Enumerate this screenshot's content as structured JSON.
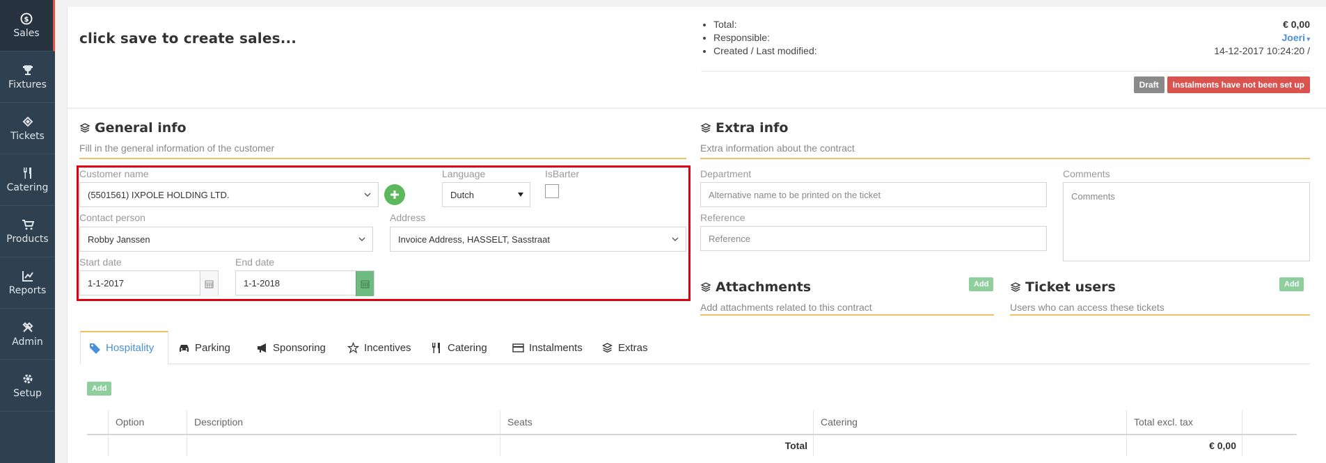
{
  "sidebar": {
    "items": [
      {
        "label": "Sales",
        "icon": "dollar-icon",
        "active": true
      },
      {
        "label": "Fixtures",
        "icon": "trophy-icon"
      },
      {
        "label": "Tickets",
        "icon": "ticket-icon"
      },
      {
        "label": "Catering",
        "icon": "cutlery-icon"
      },
      {
        "label": "Products",
        "icon": "cart-icon"
      },
      {
        "label": "Reports",
        "icon": "chart-icon"
      },
      {
        "label": "Admin",
        "icon": "tools-icon"
      },
      {
        "label": "Setup",
        "icon": "gear-icon"
      }
    ]
  },
  "page": {
    "title": "click save to create sales..."
  },
  "summary": {
    "total_label": "Total:",
    "total_value": "€ 0,00",
    "responsible_label": "Responsible:",
    "responsible_value": "Joeri",
    "created_label": "Created / Last modified:",
    "created_value": "14-12-2017 10:24:20 /"
  },
  "badges": {
    "status": "Draft",
    "warning": "Instalments have not been set up"
  },
  "general_info": {
    "title": "General info",
    "subtitle": "Fill in the general information of the customer",
    "customer_label": "Customer name",
    "customer_value": "(5501561) IXPOLE HOLDING LTD.",
    "language_label": "Language",
    "language_value": "Dutch",
    "isbarter_label": "IsBarter",
    "contact_label": "Contact person",
    "contact_value": "Robby Janssen",
    "address_label": "Address",
    "address_value": "Invoice Address, HASSELT, Sasstraat",
    "start_label": "Start date",
    "start_value": "1-1-2017",
    "end_label": "End date",
    "end_value": "1-1-2018"
  },
  "extra_info": {
    "title": "Extra info",
    "subtitle": "Extra information about the contract",
    "department_label": "Department",
    "department_placeholder": "Alternative name to be printed on the ticket",
    "reference_label": "Reference",
    "reference_placeholder": "Reference",
    "comments_label": "Comments",
    "comments_placeholder": "Comments"
  },
  "attachments": {
    "title": "Attachments",
    "subtitle": "Add attachments related to this contract",
    "add_label": "Add"
  },
  "ticket_users": {
    "title": "Ticket users",
    "subtitle": "Users who can access these tickets",
    "add_label": "Add"
  },
  "tabs": [
    {
      "label": "Hospitality",
      "icon": "tag-icon",
      "active": true
    },
    {
      "label": "Parking",
      "icon": "car-icon"
    },
    {
      "label": "Sponsoring",
      "icon": "megaphone-icon"
    },
    {
      "label": "Incentives",
      "icon": "star-icon"
    },
    {
      "label": "Catering",
      "icon": "cutlery-icon"
    },
    {
      "label": "Instalments",
      "icon": "credit-card-icon"
    },
    {
      "label": "Extras",
      "icon": "layers-icon"
    }
  ],
  "table": {
    "add_label": "Add",
    "columns": [
      "Option",
      "Description",
      "Seats",
      "Catering",
      "Total excl. tax"
    ],
    "total_label": "Total",
    "total_value": "€ 0,00"
  }
}
